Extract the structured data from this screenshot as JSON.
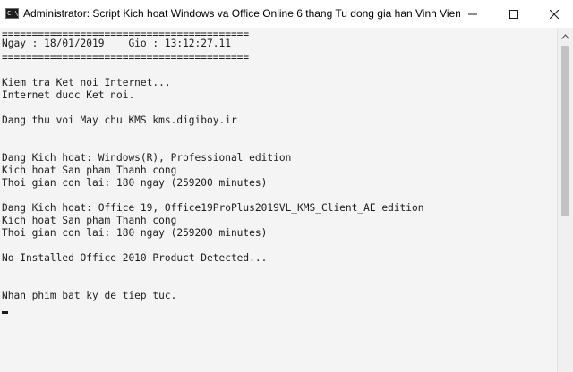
{
  "window": {
    "title": "Administrator:  Script Kich hoat Windows va Office Online 6 thang Tu dong gia han Vinh Vien - Copyrig...",
    "icon_label": "C:\\",
    "controls": [
      "minimize-icon",
      "maximize-icon",
      "close-icon"
    ]
  },
  "console": {
    "lines": [
      "=========================================",
      "Ngay : 18/01/2019    Gio : 13:12:27.11",
      "=========================================",
      "",
      "Kiem tra Ket noi Internet...",
      "Internet duoc Ket noi.",
      "",
      "Dang thu voi May chu KMS kms.digiboy.ir",
      "",
      "",
      "Dang Kich hoat: Windows(R), Professional edition",
      "Kich hoat San pham Thanh cong",
      "Thoi gian con lai: 180 ngay (259200 minutes)",
      "",
      "Dang Kich hoat: Office 19, Office19ProPlus2019VL_KMS_Client_AE edition",
      "Kich hoat San pham Thanh cong",
      "Thoi gian con lai: 180 ngay (259200 minutes)",
      "",
      "No Installed Office 2010 Product Detected...",
      "",
      "",
      "Nhan phim bat ky de tiep tuc."
    ]
  },
  "colors": {
    "console_bg": "#f4f4f4",
    "console_text": "#1c1c1c",
    "titlebar_bg": "#ffffff"
  }
}
